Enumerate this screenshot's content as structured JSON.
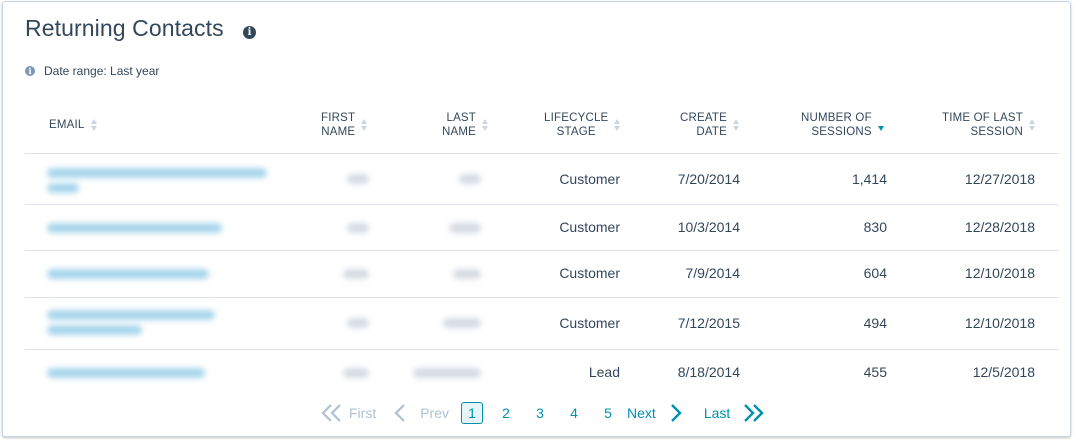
{
  "report": {
    "title": "Returning Contacts",
    "title_info_icon": "info-icon",
    "date_range_label": "Date range: Last year"
  },
  "columns": [
    {
      "key": "email",
      "label": "EMAIL",
      "line1": "EMAIL",
      "line2": "",
      "sort": "none"
    },
    {
      "key": "first_name",
      "label": "FIRST NAME",
      "line1": "FIRST",
      "line2": "NAME",
      "sort": "none"
    },
    {
      "key": "last_name",
      "label": "LAST NAME",
      "line1": "LAST",
      "line2": "NAME",
      "sort": "none"
    },
    {
      "key": "lifecycle_stage",
      "label": "LIFECYCLE STAGE",
      "line1": "LIFECYCLE",
      "line2": "STAGE",
      "sort": "none"
    },
    {
      "key": "create_date",
      "label": "CREATE DATE",
      "line1": "CREATE",
      "line2": "DATE",
      "sort": "none"
    },
    {
      "key": "sessions",
      "label": "NUMBER OF SESSIONS",
      "line1": "NUMBER OF",
      "line2": "SESSIONS",
      "sort": "descending"
    },
    {
      "key": "last_session",
      "label": "TIME OF LAST SESSION",
      "line1": "TIME OF LAST",
      "line2": "SESSION",
      "sort": "none"
    }
  ],
  "rows": [
    {
      "lifecycle_stage": "Customer",
      "create_date": "7/20/2014",
      "sessions": "1,414",
      "last_session": "12/27/2018"
    },
    {
      "lifecycle_stage": "Customer",
      "create_date": "10/3/2014",
      "sessions": "830",
      "last_session": "12/28/2018"
    },
    {
      "lifecycle_stage": "Customer",
      "create_date": "7/9/2014",
      "sessions": "604",
      "last_session": "12/10/2018"
    },
    {
      "lifecycle_stage": "Customer",
      "create_date": "7/12/2015",
      "sessions": "494",
      "last_session": "12/10/2018"
    },
    {
      "lifecycle_stage": "Lead",
      "create_date": "8/18/2014",
      "sessions": "455",
      "last_session": "12/5/2018"
    }
  ],
  "pagination": {
    "first_label": "First",
    "prev_label": "Prev",
    "pages": [
      "1",
      "2",
      "3",
      "4",
      "5"
    ],
    "current_page": "1",
    "next_label": "Next",
    "last_label": "Last"
  },
  "colors": {
    "text": "#33475b",
    "link": "#0091ae",
    "disabled": "#b0c1d4",
    "border": "#dfe3eb"
  }
}
